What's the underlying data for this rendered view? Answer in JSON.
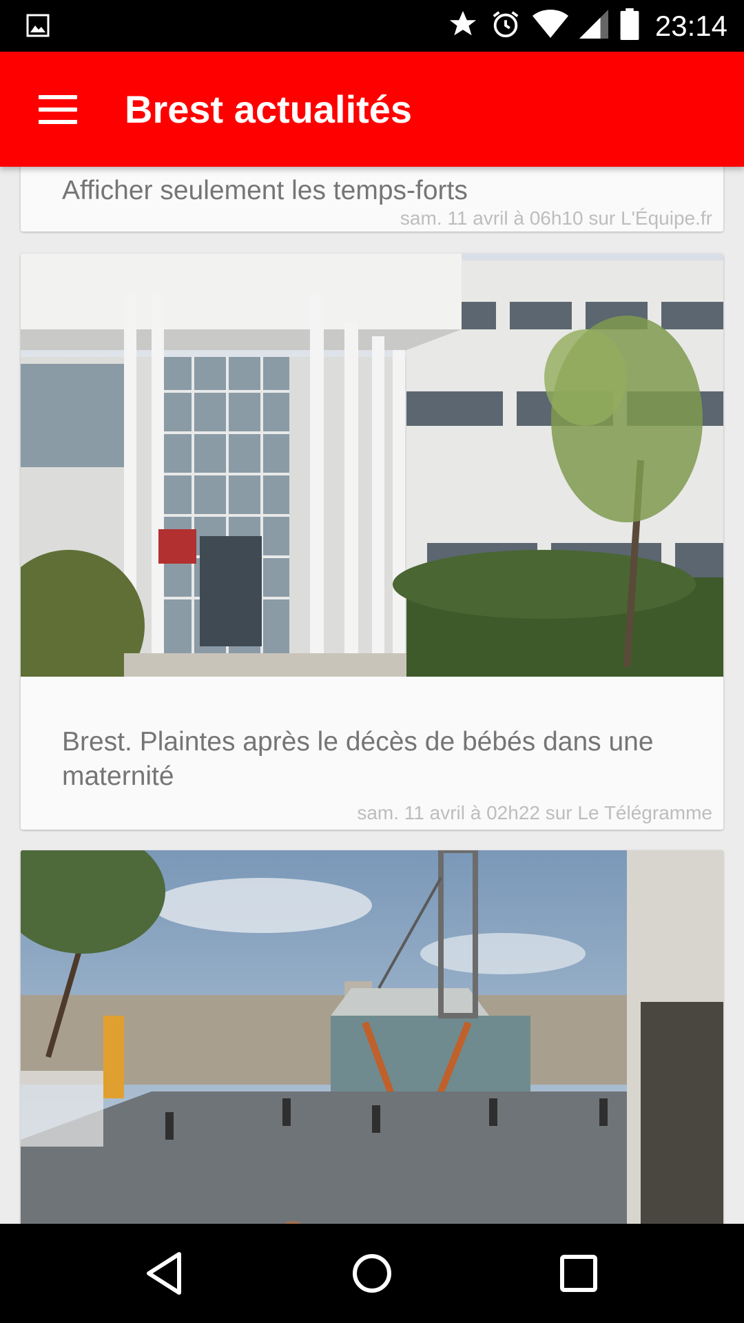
{
  "status_bar": {
    "time": "23:14",
    "icons": [
      "image-icon",
      "star-icon",
      "alarm-icon",
      "wifi-icon",
      "signal-icon",
      "battery-icon"
    ]
  },
  "app_bar": {
    "title": "Brest actualités",
    "menu_icon": "hamburger-menu-icon",
    "color": "#ff0000"
  },
  "feed": {
    "items": [
      {
        "title": "Afficher seulement les temps-forts",
        "meta": "sam. 11 avril à 06h10 sur L'Équipe.fr"
      },
      {
        "image": "hospital-building-photo",
        "title": "Brest. Plaintes après le décès de bébés dans une maternité",
        "meta": "sam. 11 avril à 02h22 sur Le Télégramme"
      },
      {
        "image": "cable-car-station-photo"
      }
    ]
  },
  "nav_bar": {
    "icons": [
      "back-icon",
      "home-icon",
      "recents-icon"
    ]
  }
}
